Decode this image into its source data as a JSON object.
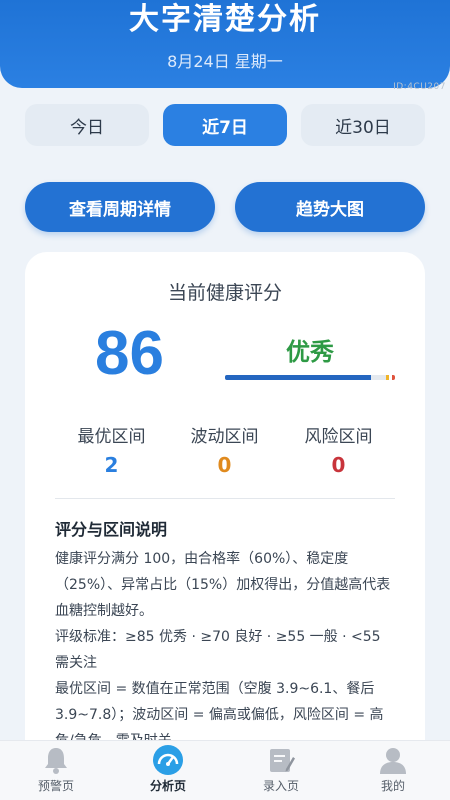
{
  "header": {
    "title": "大字清楚分析",
    "date": "8月24日 星期一",
    "watermark": "ID:4CU207"
  },
  "range_tabs": [
    {
      "label": "今日",
      "active": false
    },
    {
      "label": "近7日",
      "active": true
    },
    {
      "label": "近30日",
      "active": false
    }
  ],
  "actions": {
    "period_details": "查看周期详情",
    "trend_chart": "趋势大图"
  },
  "health": {
    "title": "当前健康评分",
    "score": "86",
    "grade": "优秀",
    "grade_color": "#2e9a45",
    "bar_fraction": 0.86,
    "zones": [
      {
        "label": "最优区间",
        "value": "2",
        "color": "#2a7fdf"
      },
      {
        "label": "波动区间",
        "value": "0",
        "color": "#e08a1e"
      },
      {
        "label": "风险区间",
        "value": "0",
        "color": "#c8343b"
      }
    ]
  },
  "explanation": {
    "heading": "评分与区间说明",
    "paragraphs": [
      "健康评分满分 100，由合格率（60%）、稳定度（25%）、异常占比（15%）加权得出，分值越高代表血糖控制越好。",
      "评级标准：≥85 优秀 · ≥70 良好 · ≥55 一般 · <55 需关注",
      "最优区间 = 数值在正常范围（空腹 3.9~6.1、餐后 3.9~7.8）；波动区间 = 偏高或偏低，风险区间 = 高危/急危，需及时关"
    ]
  },
  "nav": [
    {
      "label": "预警页",
      "icon": "bell-icon",
      "active": false
    },
    {
      "label": "分析页",
      "icon": "gauge-icon",
      "active": true
    },
    {
      "label": "录入页",
      "icon": "edit-note-icon",
      "active": false
    },
    {
      "label": "我的",
      "icon": "user-icon",
      "active": false
    }
  ],
  "colors": {
    "primary": "#2b80e2",
    "button": "#2372d3",
    "background": "#eef3f9"
  }
}
